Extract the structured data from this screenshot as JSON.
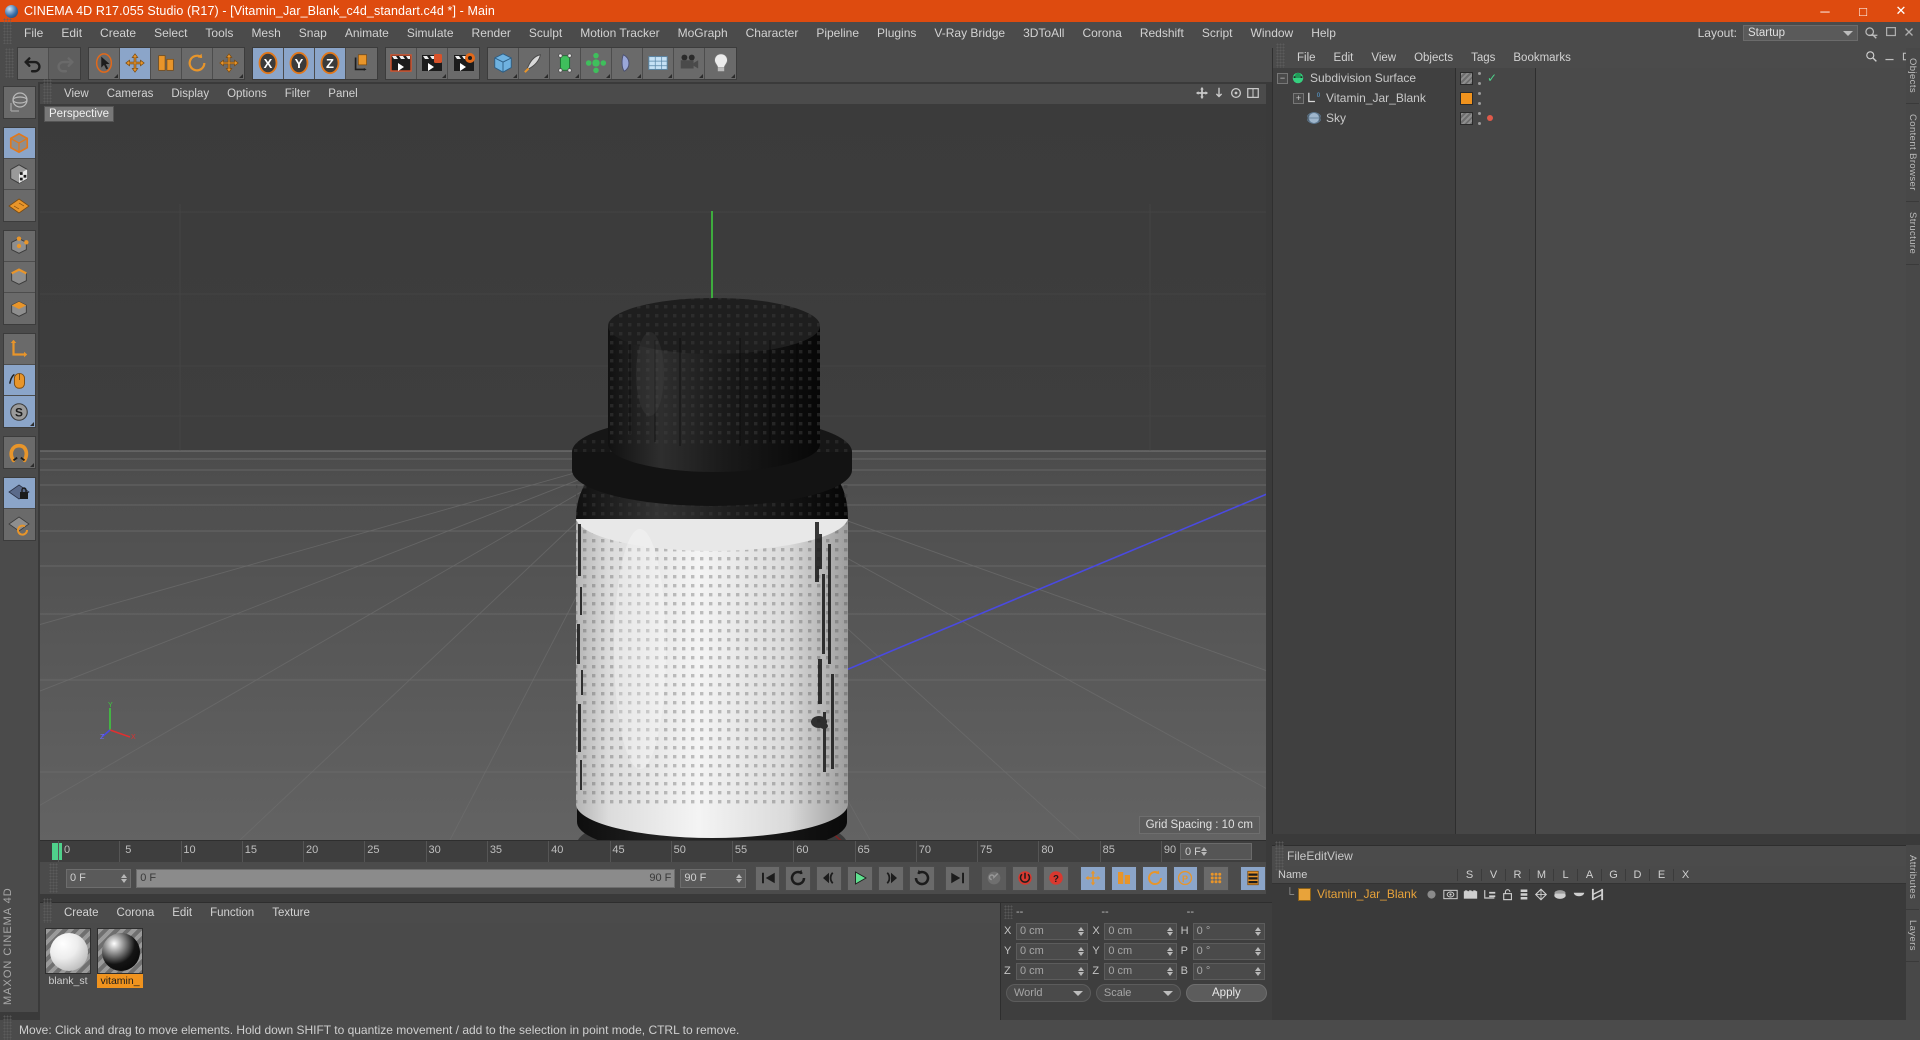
{
  "window": {
    "title": "CINEMA 4D R17.055 Studio (R17) - [Vitamin_Jar_Blank_c4d_standart.c4d *] - Main",
    "minimize": "─",
    "maximize": "□",
    "close": "✕"
  },
  "menubar": {
    "items": [
      "File",
      "Edit",
      "Create",
      "Select",
      "Tools",
      "Mesh",
      "Snap",
      "Animate",
      "Simulate",
      "Render",
      "Sculpt",
      "Motion Tracker",
      "MoGraph",
      "Character",
      "Pipeline",
      "Plugins",
      "V-Ray Bridge",
      "3DToAll",
      "Corona",
      "Redshift",
      "Script",
      "Window",
      "Help"
    ],
    "layout_label": "Layout:",
    "layout_value": "Startup"
  },
  "viewport": {
    "menu": [
      "View",
      "Cameras",
      "Display",
      "Options",
      "Filter",
      "Panel"
    ],
    "label": "Perspective",
    "grid_spacing": "Grid Spacing : 10 cm"
  },
  "object_manager": {
    "menu": [
      "File",
      "Edit",
      "View",
      "Objects",
      "Tags",
      "Bookmarks"
    ],
    "rows": [
      {
        "name": "Subdivision Surface",
        "indent": 4,
        "icon": "subdivision-surface-icon",
        "tag": "hatch",
        "marker": "check"
      },
      {
        "name": "Vitamin_Jar_Blank",
        "indent": 20,
        "icon": "null-object-icon",
        "tag": "orange",
        "marker": "none"
      },
      {
        "name": "Sky",
        "indent": 20,
        "icon": "sky-icon",
        "tag": "hatch",
        "marker": "reddot"
      }
    ]
  },
  "timeline": {
    "ticks": [
      0,
      5,
      10,
      15,
      20,
      25,
      30,
      35,
      40,
      45,
      50,
      55,
      60,
      65,
      70,
      75,
      80,
      85,
      90
    ],
    "current_frame_field": "0 F"
  },
  "animbar": {
    "start_field": "0 F",
    "range_left": "0 F",
    "range_right": "90 F",
    "end_field": "90 F"
  },
  "material_manager": {
    "menu": [
      "Create",
      "Corona",
      "Edit",
      "Function",
      "Texture"
    ],
    "materials": [
      {
        "name": "blank_st",
        "color": "#e9e9e9",
        "selected": false
      },
      {
        "name": "vitamin_",
        "color": "#141414",
        "selected": true
      }
    ]
  },
  "coordinate_manager": {
    "headers": [
      "--",
      "--",
      "--"
    ],
    "rows": [
      {
        "l1": "X",
        "v1": "0 cm",
        "l2": "X",
        "v2": "0 cm",
        "l3": "H",
        "v3": "0 °"
      },
      {
        "l1": "Y",
        "v1": "0 cm",
        "l2": "Y",
        "v2": "0 cm",
        "l3": "P",
        "v3": "0 °"
      },
      {
        "l1": "Z",
        "v1": "0 cm",
        "l2": "Z",
        "v2": "0 cm",
        "l3": "B",
        "v3": "0 °"
      }
    ],
    "system": "World",
    "mode": "Scale",
    "apply": "Apply"
  },
  "attribute_manager": {
    "menu": [
      "File",
      "Edit",
      "View"
    ],
    "columns": [
      "Name",
      "S",
      "V",
      "R",
      "M",
      "L",
      "A",
      "G",
      "D",
      "E",
      "X"
    ],
    "row_name": "Vitamin_Jar_Blank"
  },
  "status_bar": {
    "message": "Move: Click and drag to move elements. Hold down SHIFT to quantize movement / add to the selection in point mode, CTRL to remove."
  },
  "right_tabs": [
    "Objects",
    "Content Browser",
    "Structure"
  ],
  "right_tabs_lower": [
    "Attributes",
    "Layers"
  ],
  "brand": "MAXON CINEMA 4D",
  "colors": {
    "title_bar": "#de4b0f",
    "panel": "#4b4b4b",
    "accent_orange": "#f0931e",
    "active_blue": "#8ba5c9",
    "green_marker": "#4fd18b"
  }
}
